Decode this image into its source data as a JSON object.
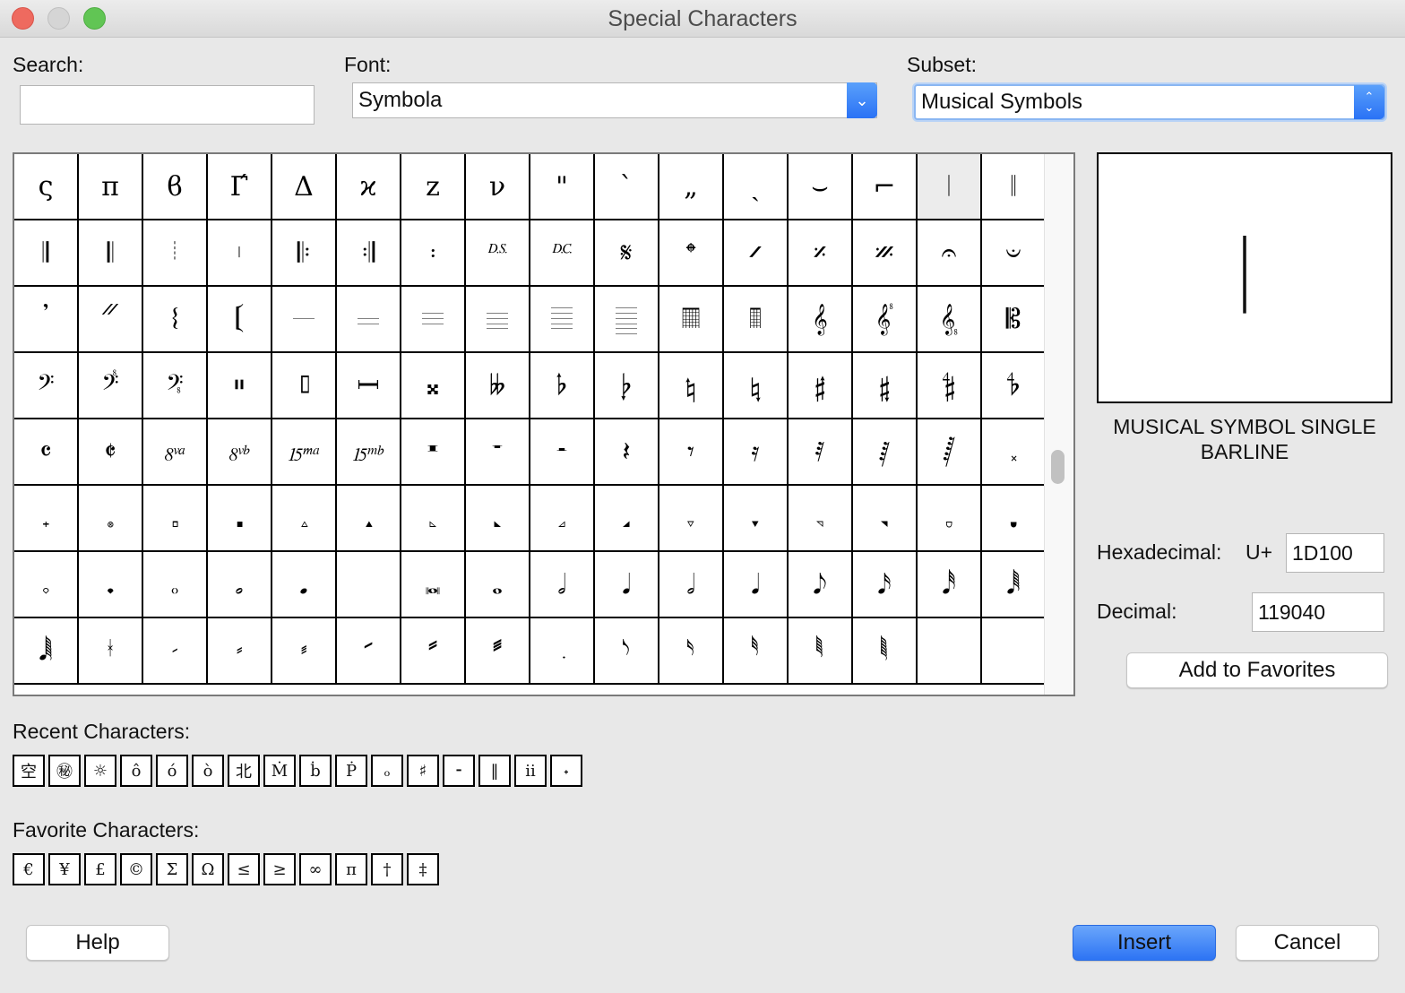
{
  "window": {
    "title": "Special Characters"
  },
  "search": {
    "label": "Search:",
    "value": ""
  },
  "font": {
    "label": "Font:",
    "value": "Symbola"
  },
  "subset": {
    "label": "Subset:",
    "value": "Musical Symbols"
  },
  "grid": {
    "selected_index": 14,
    "rows": [
      [
        "ς",
        "π",
        "ϐ",
        "Γ́",
        "Δ",
        "ϰ",
        "z",
        "ν",
        "\"",
        "`",
        "„",
        "ˎ",
        "⌣",
        "⌐",
        "𝄀",
        "𝄁"
      ],
      [
        "𝄂",
        "𝄃",
        "𝄄",
        "𝄅",
        "𝄆",
        "𝄇",
        "𝄈",
        "𝄉",
        "𝄊",
        "𝄋",
        "𝄌",
        "𝄍",
        "𝄎",
        "𝄏",
        "𝄐",
        "𝄑"
      ],
      [
        "𝄒",
        "𝄓",
        "𝄔",
        "𝄕",
        "𝄖",
        "𝄗",
        "𝄘",
        "𝄙",
        "𝄚",
        "𝄛",
        "𝄜",
        "𝄝",
        "𝄞",
        "𝄟",
        "𝄠",
        "𝄡"
      ],
      [
        "𝄢",
        "𝄣",
        "𝄤",
        "𝄥",
        "𝄦",
        "𝄩",
        "𝄪",
        "𝄫",
        "𝄬",
        "𝄭",
        "𝄮",
        "𝄯",
        "𝄰",
        "𝄱",
        "𝄲",
        "𝄳"
      ],
      [
        "𝄴",
        "𝄵",
        "𝄶",
        "𝄷",
        "𝄸",
        "𝄹",
        "𝄺",
        "𝄻",
        "𝄼",
        "𝄽",
        "𝄾",
        "𝄿",
        "𝅀",
        "𝅁",
        "𝅂",
        "𝅃"
      ],
      [
        "𝅄",
        "𝅅",
        "𝅆",
        "𝅇",
        "𝅈",
        "𝅉",
        "𝅊",
        "𝅋",
        "𝅌",
        "𝅍",
        "𝅎",
        "𝅏",
        "𝅐",
        "𝅑",
        "𝅒",
        "𝅓"
      ],
      [
        "𝅔",
        "𝅕",
        "𝅖",
        "𝅗",
        "𝅘",
        "",
        "𝅜",
        "𝅝",
        "𝅗𝅥",
        "𝅘𝅥",
        "𝅗𝅥",
        "𝅘𝅥",
        "𝅘𝅥𝅮",
        "𝅘𝅥𝅯",
        "𝅘𝅥𝅰",
        "𝅘𝅥𝅱"
      ],
      [
        "𝅘𝅥𝅲",
        "𝅦",
        "𝅧",
        "𝅨",
        "𝅩",
        "𝅪",
        "𝅫",
        "𝅬",
        "𝅭",
        "𝅮",
        "𝅯",
        "𝅰",
        "𝅱",
        "𝅲",
        "𝅳",
        ""
      ]
    ]
  },
  "preview": {
    "glyph": "𝄀",
    "name": "MUSICAL SYMBOL SINGLE BARLINE"
  },
  "codes": {
    "hex_label": "Hexadecimal:",
    "hex_prefix": "U+",
    "hex_value": "1D100",
    "dec_label": "Decimal:",
    "dec_value": "119040"
  },
  "buttons": {
    "add_favorites": "Add to Favorites",
    "help": "Help",
    "insert": "Insert",
    "cancel": "Cancel"
  },
  "recent": {
    "label": "Recent Characters:",
    "chars": [
      "空",
      "㊙",
      "☼",
      "ô",
      "ó",
      "ò",
      "北",
      "Ṁ",
      "ḃ",
      "Ṗ",
      "ₒ",
      "♯",
      "⁃",
      "‖",
      "ⅱ",
      "˖"
    ]
  },
  "favorites": {
    "label": "Favorite Characters:",
    "chars": [
      "€",
      "¥",
      "£",
      "©",
      "Σ",
      "Ω",
      "≤",
      "≥",
      "∞",
      "π",
      "†",
      "‡"
    ]
  },
  "colors": {
    "accent": "#2d74f4",
    "close": "#ee6a5f",
    "maximize": "#61c554"
  }
}
